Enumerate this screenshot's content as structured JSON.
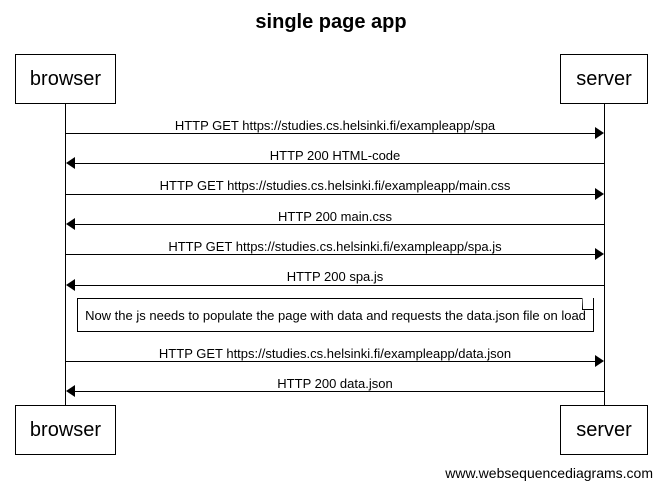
{
  "title": "single page app",
  "participants": {
    "browser": "browser",
    "server": "server"
  },
  "messages": [
    {
      "label": "HTTP GET https://studies.cs.helsinki.fi/exampleapp/spa",
      "direction": "browser-to-server"
    },
    {
      "label": "HTTP 200 HTML-code",
      "direction": "server-to-browser"
    },
    {
      "label": "HTTP GET https://studies.cs.helsinki.fi/exampleapp/main.css",
      "direction": "browser-to-server"
    },
    {
      "label": "HTTP 200 main.css",
      "direction": "server-to-browser"
    },
    {
      "label": "HTTP GET https://studies.cs.helsinki.fi/exampleapp/spa.js",
      "direction": "browser-to-server"
    },
    {
      "label": "HTTP 200 spa.js",
      "direction": "server-to-browser"
    },
    {
      "label": "HTTP GET https://studies.cs.helsinki.fi/exampleapp/data.json",
      "direction": "browser-to-server"
    },
    {
      "label": "HTTP 200 data.json",
      "direction": "server-to-browser"
    }
  ],
  "note": "Now the js needs to populate the page with data and requests the data.json file on load",
  "watermark": "www.websequencediagrams.com"
}
